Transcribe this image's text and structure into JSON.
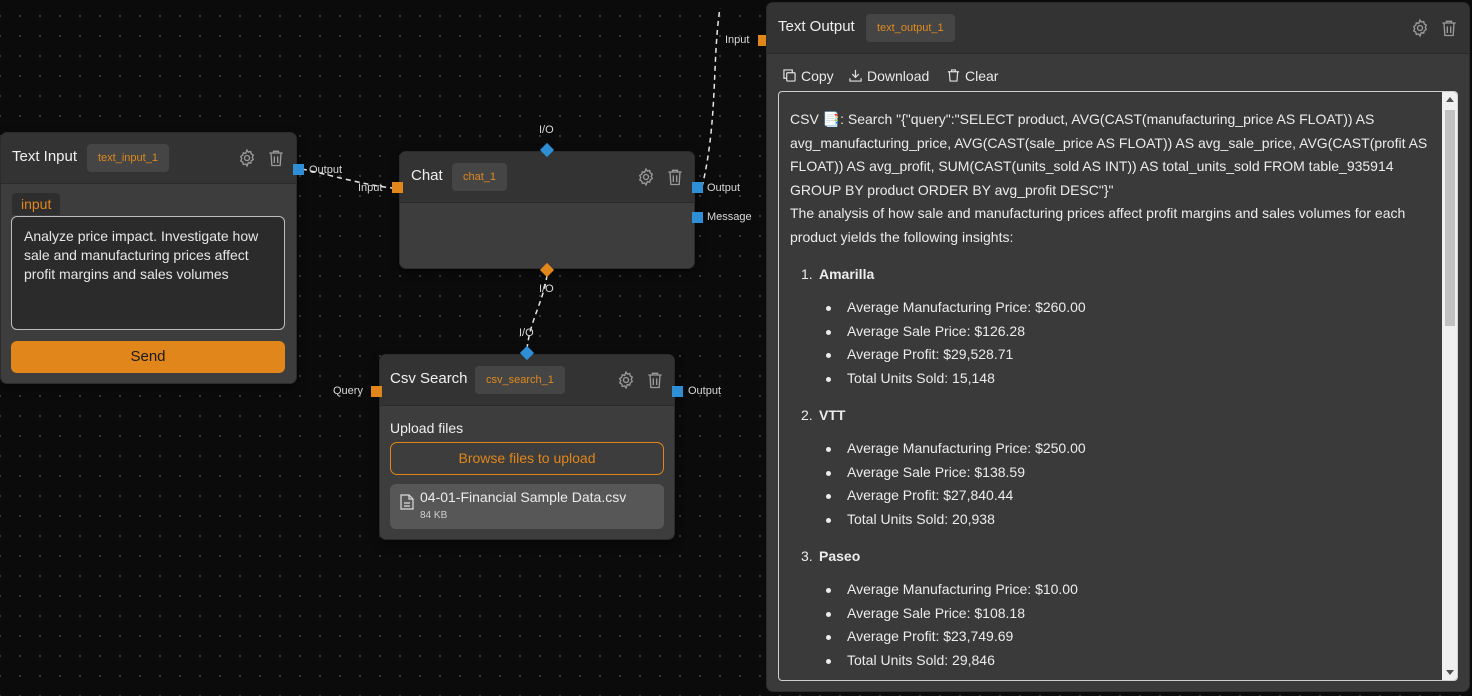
{
  "nodes": {
    "text_input": {
      "title": "Text Input",
      "id": "text_input_1",
      "field_label": "input",
      "value": "Analyze price impact. Investigate how sale and manufacturing prices affect profit margins and sales volumes",
      "send_label": "Send",
      "output_label": "Output"
    },
    "chat": {
      "title": "Chat",
      "id": "chat_1",
      "input_label": "Input",
      "output_label": "Output",
      "message_label": "Message",
      "io_top_label": "I/O",
      "io_bottom_label": "I/O"
    },
    "csv_search": {
      "title": "Csv Search",
      "id": "csv_search_1",
      "io_label": "I/O",
      "query_label": "Query",
      "output_label": "Output",
      "upload_label": "Upload files",
      "browse_label": "Browse files to upload",
      "file_name": "04-01-Financial Sample Data.csv",
      "file_size": "84 KB"
    }
  },
  "text_output": {
    "title": "Text Output",
    "id": "text_output_1",
    "input_label": "Input",
    "toolbar": {
      "copy": "Copy",
      "download": "Download",
      "clear": "Clear"
    },
    "query_text": "CSV 📑: Search \"{\"query\":\"SELECT product, AVG(CAST(manufacturing_price AS FLOAT)) AS avg_manufacturing_price, AVG(CAST(sale_price AS FLOAT)) AS avg_sale_price, AVG(CAST(profit AS FLOAT)) AS avg_profit, SUM(CAST(units_sold AS INT)) AS total_units_sold FROM table_935914 GROUP BY product ORDER BY avg_profit DESC\"}\"",
    "intro": "The analysis of how sale and manufacturing prices affect profit margins and sales volumes for each product yields the following insights:",
    "products": [
      {
        "num": "1.",
        "name": "Amarilla",
        "items": [
          "Average Manufacturing Price: $260.00",
          "Average Sale Price: $126.28",
          "Average Profit: $29,528.71",
          "Total Units Sold: 15,148"
        ]
      },
      {
        "num": "2.",
        "name": "VTT",
        "items": [
          "Average Manufacturing Price: $250.00",
          "Average Sale Price: $138.59",
          "Average Profit: $27,840.44",
          "Total Units Sold: 20,938"
        ]
      },
      {
        "num": "3.",
        "name": "Paseo",
        "items": [
          "Average Manufacturing Price: $10.00",
          "Average Sale Price: $108.18",
          "Average Profit: $23,749.69",
          "Total Units Sold: 29,846"
        ]
      }
    ]
  },
  "colors": {
    "accent": "#e0861b",
    "handle_blue": "#2e8fd6",
    "canvas": "#0b0b0b",
    "node_bg": "#3d3d3d"
  },
  "icons": [
    "gear-icon",
    "trash-icon",
    "copy-icon",
    "download-icon",
    "file-icon"
  ]
}
